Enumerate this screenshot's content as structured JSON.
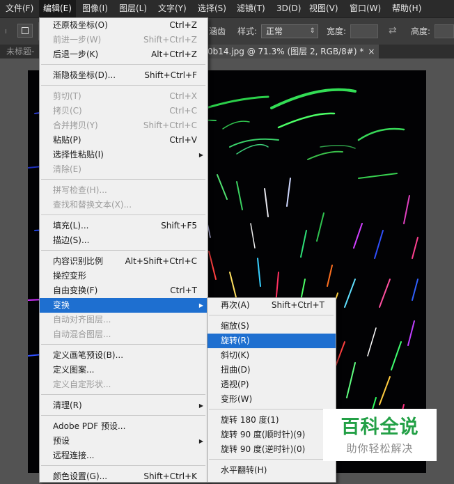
{
  "menubar": {
    "items": [
      {
        "label": "文件(F)"
      },
      {
        "label": "编辑(E)"
      },
      {
        "label": "图像(I)"
      },
      {
        "label": "图层(L)"
      },
      {
        "label": "文字(Y)"
      },
      {
        "label": "选择(S)"
      },
      {
        "label": "滤镜(T)"
      },
      {
        "label": "3D(D)"
      },
      {
        "label": "视图(V)"
      },
      {
        "label": "窗口(W)"
      },
      {
        "label": "帮助(H)"
      }
    ]
  },
  "options": {
    "partial_label": "涵齿",
    "style_label": "样式:",
    "style_value": "正常",
    "width_label": "宽度:",
    "height_label": "高度:"
  },
  "tabs": {
    "first": "未标题-",
    "active_name": "0b14.jpg @ 71.3% (图层 2, RGB/8#) *",
    "close": "×"
  },
  "edit_menu": {
    "items": [
      {
        "label": "还原极坐标(O)",
        "shortcut": "Ctrl+Z",
        "state": "enabled"
      },
      {
        "label": "前进一步(W)",
        "shortcut": "Shift+Ctrl+Z",
        "state": "disabled"
      },
      {
        "label": "后退一步(K)",
        "shortcut": "Alt+Ctrl+Z",
        "state": "enabled"
      },
      {
        "label": "渐隐极坐标(D)...",
        "shortcut": "Shift+Ctrl+F",
        "state": "enabled"
      },
      {
        "label": "剪切(T)",
        "shortcut": "Ctrl+X",
        "state": "disabled"
      },
      {
        "label": "拷贝(C)",
        "shortcut": "Ctrl+C",
        "state": "disabled"
      },
      {
        "label": "合并拷贝(Y)",
        "shortcut": "Shift+Ctrl+C",
        "state": "disabled"
      },
      {
        "label": "粘贴(P)",
        "shortcut": "Ctrl+V",
        "state": "enabled"
      },
      {
        "label": "选择性粘贴(I)",
        "shortcut": "",
        "state": "enabled",
        "submenu": true
      },
      {
        "label": "清除(E)",
        "shortcut": "",
        "state": "disabled"
      },
      {
        "label": "拼写检查(H)...",
        "shortcut": "",
        "state": "disabled"
      },
      {
        "label": "查找和替换文本(X)...",
        "shortcut": "",
        "state": "disabled"
      },
      {
        "label": "填充(L)...",
        "shortcut": "Shift+F5",
        "state": "enabled"
      },
      {
        "label": "描边(S)...",
        "shortcut": "",
        "state": "enabled"
      },
      {
        "label": "内容识别比例",
        "shortcut": "Alt+Shift+Ctrl+C",
        "state": "enabled"
      },
      {
        "label": "操控变形",
        "shortcut": "",
        "state": "enabled"
      },
      {
        "label": "自由变换(F)",
        "shortcut": "Ctrl+T",
        "state": "enabled"
      },
      {
        "label": "变换",
        "shortcut": "",
        "state": "highlighted",
        "submenu": true
      },
      {
        "label": "自动对齐图层...",
        "shortcut": "",
        "state": "disabled"
      },
      {
        "label": "自动混合图层...",
        "shortcut": "",
        "state": "disabled"
      },
      {
        "label": "定义画笔预设(B)...",
        "shortcut": "",
        "state": "enabled"
      },
      {
        "label": "定义图案...",
        "shortcut": "",
        "state": "enabled"
      },
      {
        "label": "定义自定形状...",
        "shortcut": "",
        "state": "disabled"
      },
      {
        "label": "清理(R)",
        "shortcut": "",
        "state": "enabled",
        "submenu": true
      },
      {
        "label": "Adobe PDF 预设...",
        "shortcut": "",
        "state": "enabled"
      },
      {
        "label": "预设",
        "shortcut": "",
        "state": "enabled",
        "submenu": true
      },
      {
        "label": "远程连接...",
        "shortcut": "",
        "state": "enabled"
      },
      {
        "label": "颜色设置(G)...",
        "shortcut": "Shift+Ctrl+K",
        "state": "enabled"
      }
    ]
  },
  "transform_menu": {
    "items": [
      {
        "label": "再次(A)",
        "shortcut": "Shift+Ctrl+T",
        "state": "enabled"
      },
      {
        "label": "缩放(S)",
        "shortcut": "",
        "state": "enabled"
      },
      {
        "label": "旋转(R)",
        "shortcut": "",
        "state": "highlighted"
      },
      {
        "label": "斜切(K)",
        "shortcut": "",
        "state": "enabled"
      },
      {
        "label": "扭曲(D)",
        "shortcut": "",
        "state": "enabled"
      },
      {
        "label": "透视(P)",
        "shortcut": "",
        "state": "enabled"
      },
      {
        "label": "变形(W)",
        "shortcut": "",
        "state": "enabled"
      },
      {
        "label": "旋转 180 度(1)",
        "shortcut": "",
        "state": "enabled"
      },
      {
        "label": "旋转 90 度(顺时针)(9)",
        "shortcut": "",
        "state": "enabled"
      },
      {
        "label": "旋转 90 度(逆时针)(0)",
        "shortcut": "",
        "state": "enabled"
      },
      {
        "label": "水平翻转(H)",
        "shortcut": "",
        "state": "enabled"
      }
    ]
  },
  "watermark": {
    "title": "百科全说",
    "subtitle": "助你轻松解决"
  },
  "colors": {
    "menu_highlight": "#1e6fd0",
    "menu_bg": "#f0f0f0",
    "watermark_green": "#23a046"
  }
}
